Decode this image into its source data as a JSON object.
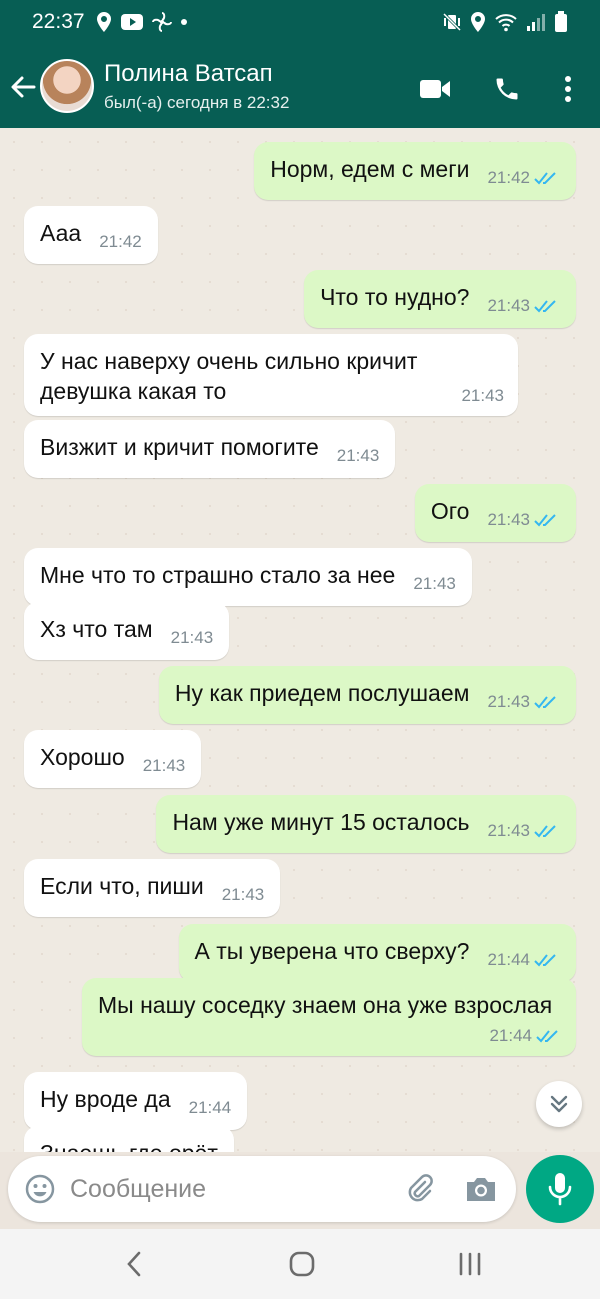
{
  "status_bar": {
    "time": "22:37"
  },
  "header": {
    "contact_name": "Полина Ватсап",
    "contact_status": "был(-а) сегодня в 22:32"
  },
  "messages": [
    {
      "direction": "outgoing",
      "text": "Норм, едем с меги",
      "time": "21:42",
      "read": true
    },
    {
      "direction": "incoming",
      "text": "Ааа",
      "time": "21:42"
    },
    {
      "direction": "outgoing",
      "text": "Что то нудно?",
      "time": "21:43",
      "read": true
    },
    {
      "direction": "incoming",
      "text": "У нас наверху очень сильно кричит девушка какая то",
      "time": "21:43"
    },
    {
      "direction": "incoming",
      "text": "Визжит и кричит помогите",
      "time": "21:43"
    },
    {
      "direction": "outgoing",
      "text": "Ого",
      "time": "21:43",
      "read": true
    },
    {
      "direction": "incoming",
      "text": "Мне что то страшно стало за нее",
      "time": "21:43"
    },
    {
      "direction": "incoming",
      "text": "Хз что там",
      "time": "21:43"
    },
    {
      "direction": "outgoing",
      "text": "Ну как приедем послушаем",
      "time": "21:43",
      "read": true
    },
    {
      "direction": "incoming",
      "text": "Хорошо",
      "time": "21:43"
    },
    {
      "direction": "outgoing",
      "text": "Нам уже минут 15 осталось",
      "time": "21:43",
      "read": true
    },
    {
      "direction": "incoming",
      "text": "Если что, пиши",
      "time": "21:43"
    },
    {
      "direction": "outgoing",
      "text": "А ты уверена что сверху?",
      "time": "21:44",
      "read": true
    },
    {
      "direction": "outgoing",
      "text": "Мы нашу соседку знаем она уже взрослая",
      "time": "21:44",
      "read": true
    },
    {
      "direction": "incoming",
      "text": "Ну вроде да",
      "time": "21:44"
    },
    {
      "direction": "incoming",
      "text": "Знаешь где орёт",
      "time": ""
    }
  ],
  "composer": {
    "placeholder": "Сообщение"
  },
  "icons": {
    "back": "arrow-left-icon",
    "video": "video-camera-icon",
    "call": "phone-icon",
    "menu": "more-vertical-icon",
    "emoji": "emoji-icon",
    "attach": "paperclip-icon",
    "camera": "camera-icon",
    "mic": "microphone-icon",
    "scroll": "chevrons-down-icon"
  },
  "colors": {
    "header": "#075e54",
    "outgoing_bubble": "#dcf8c6",
    "incoming_bubble": "#ffffff",
    "read_ticks": "#34b7f1",
    "mic_button": "#00a884"
  }
}
